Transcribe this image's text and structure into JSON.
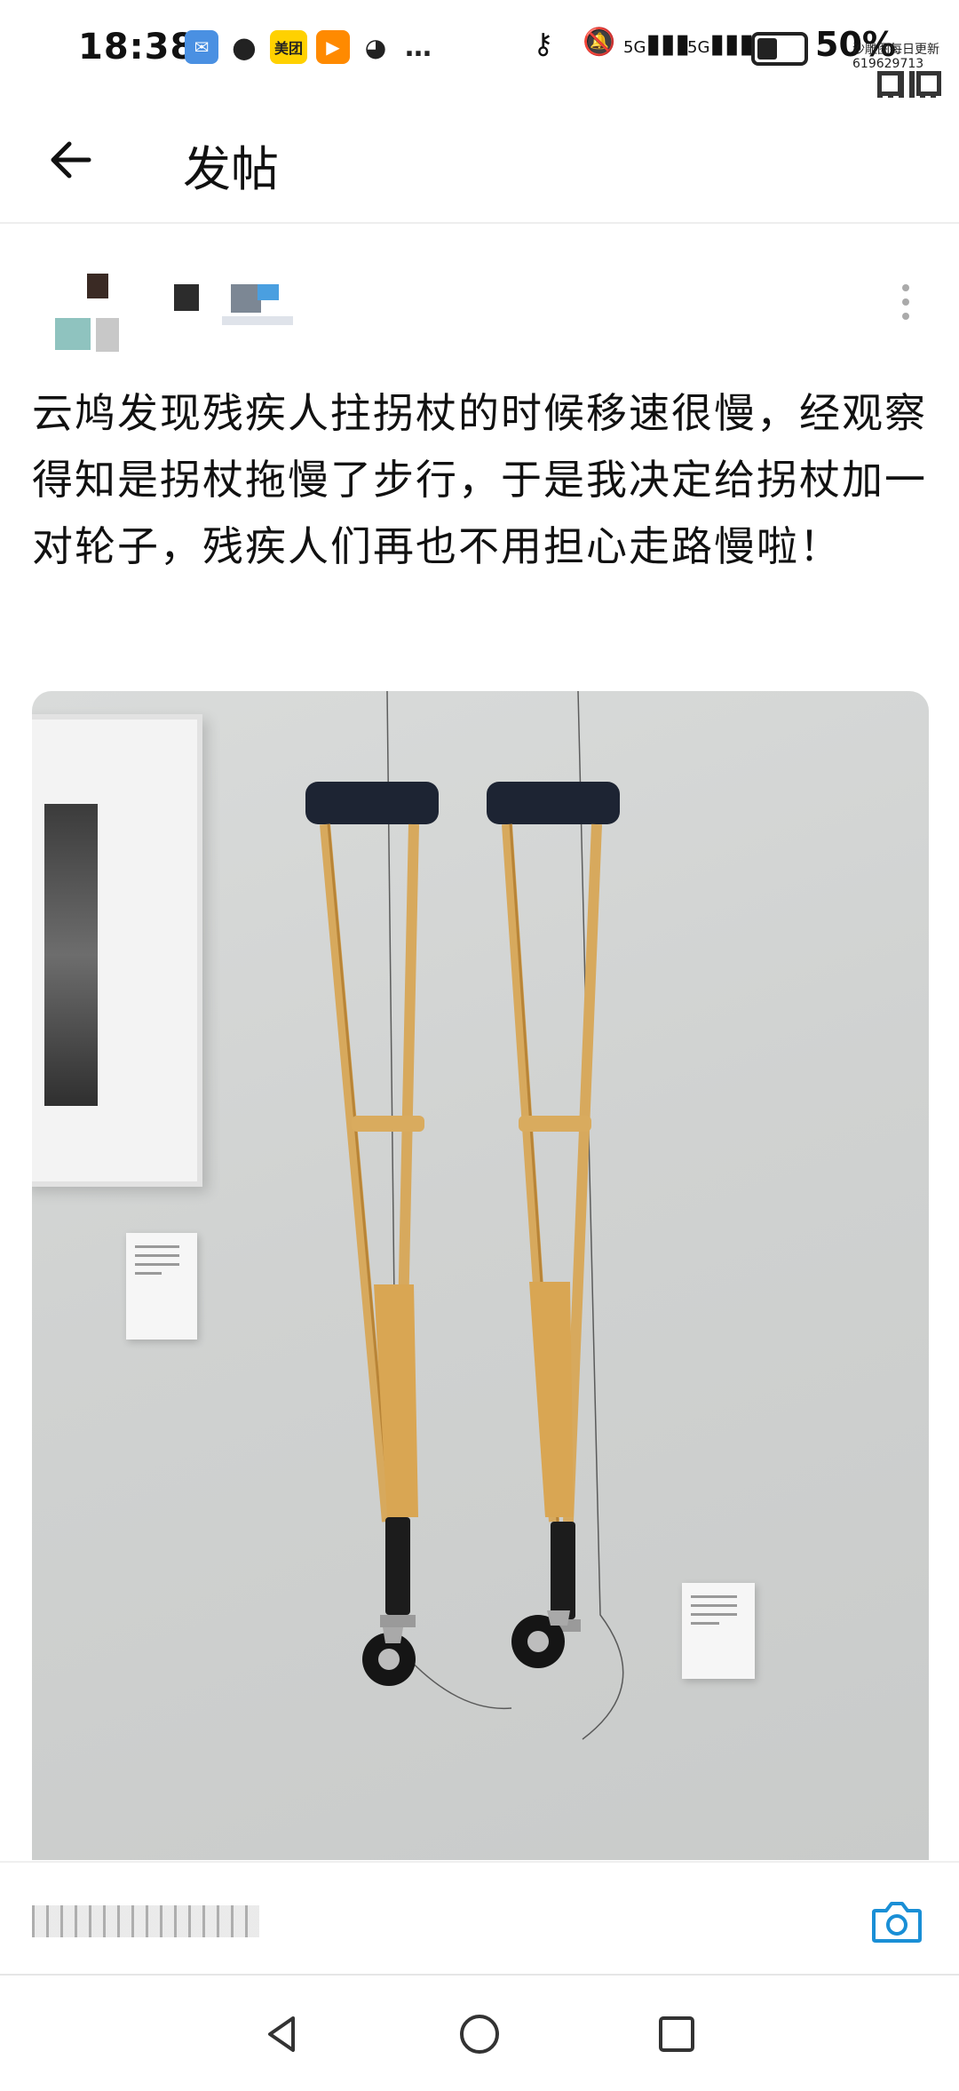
{
  "status_bar": {
    "time": "18:38",
    "app_icons": [
      "mail-icon",
      "qq-icon",
      "meituan-icon",
      "video-icon",
      "wechat-icon",
      "more-dots-icon"
    ],
    "meituan_label": "美团",
    "network_1": "5G",
    "network_2": "5G",
    "battery_level": 0.5,
    "battery_text": "50%",
    "watermark_text": "沙雕图每日更新",
    "watermark_id": "619629713"
  },
  "header": {
    "title": "发帖"
  },
  "post": {
    "text": "云鸠发现残疾人拄拐杖的时候移速很慢，经观察得知是拐杖拖慢了步行，于是我决定给拐杖加一对轮子，残疾人们再也不用担心走路慢啦！"
  },
  "composer": {
    "input_value": "",
    "camera_icon": "camera-icon"
  },
  "colors": {
    "accent": "#1a8fd6",
    "text": "#111111",
    "divider": "#eeeeee"
  }
}
